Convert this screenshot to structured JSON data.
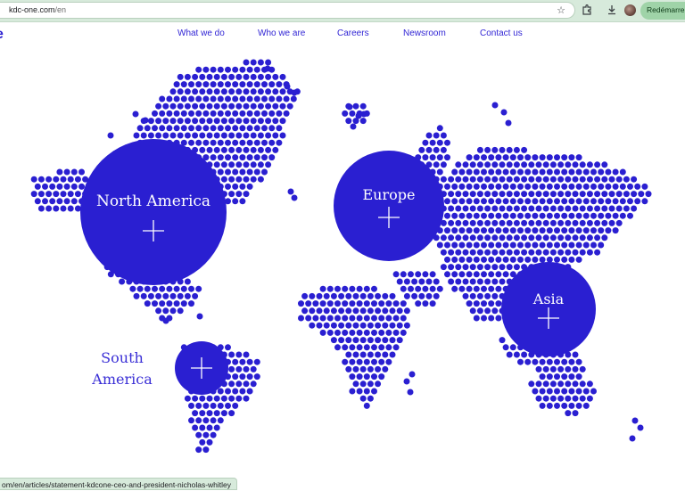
{
  "browser": {
    "url_host": "kdc-one.com",
    "url_path": "/en",
    "restart_label": "Redémarrer p",
    "status_url": "om/en/articles/statement-kdcone-ceo-and-president-nicholas-whitley"
  },
  "site": {
    "logo_fragment": "e",
    "nav": [
      {
        "label": "What we do"
      },
      {
        "label": "Who we are"
      },
      {
        "label": "Careers"
      },
      {
        "label": "Newsroom"
      },
      {
        "label": "Contact us"
      }
    ]
  },
  "map": {
    "dot_color": "#2a1fd1",
    "regions": [
      {
        "name": "North America"
      },
      {
        "name": "Europe"
      },
      {
        "name": "Asia"
      }
    ],
    "south_america": {
      "line1": "South",
      "line2": "America"
    }
  }
}
